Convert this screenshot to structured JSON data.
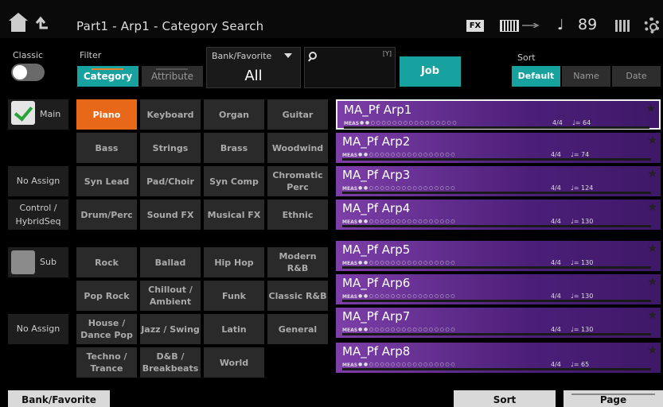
{
  "header": {
    "title": "Part1 - Arp1 - Category Search",
    "fx": "FX",
    "tempo": "89",
    "note_symbol": "♩",
    "icons": [
      "home-icon",
      "back-icon",
      "keyboard-icon",
      "usb-icon",
      "grid-icon",
      "gear-icon"
    ]
  },
  "controls": {
    "classic_label": "Classic",
    "filter_label": "Filter",
    "filter_tabs": [
      "Category",
      "Attribute"
    ],
    "bank_label": "Bank/Favorite",
    "bank_value": "All",
    "search_badge": "[Y]",
    "job": "Job",
    "sort_label": "Sort",
    "sort_options": [
      "Default",
      "Name",
      "Date"
    ]
  },
  "side": {
    "main": "Main",
    "no_assign_1": "No Assign",
    "control_hybrid": "Control / HybridSeq",
    "sub": "Sub",
    "no_assign_2": "No Assign"
  },
  "main_categories": [
    [
      "Piano",
      "Keyboard",
      "Organ",
      "Guitar"
    ],
    [
      "Bass",
      "Strings",
      "Brass",
      "Woodwind"
    ],
    [
      "Syn Lead",
      "Pad/Choir",
      "Syn Comp",
      "Chromatic Perc"
    ],
    [
      "Drum/Perc",
      "Sound FX",
      "Musical FX",
      "Ethnic"
    ]
  ],
  "sub_categories": [
    [
      "Rock",
      "Ballad",
      "Hip Hop",
      "Modern R&B"
    ],
    [
      "Pop Rock",
      "Chillout / Ambient",
      "Funk",
      "Classic R&B"
    ],
    [
      "House / Dance Pop",
      "Jazz / Swing",
      "Latin",
      "General"
    ],
    [
      "Techno / Trance",
      "D&B / Breakbeats",
      "World",
      ""
    ]
  ],
  "arps": [
    {
      "name": "MA_Pf Arp1",
      "meas": "MEAS",
      "sig": "4/4",
      "tempo": "♩= 64"
    },
    {
      "name": "MA_Pf Arp2",
      "meas": "MEAS",
      "sig": "4/4",
      "tempo": "♩= 74"
    },
    {
      "name": "MA_Pf Arp3",
      "meas": "MEAS",
      "sig": "4/4",
      "tempo": "♩= 124"
    },
    {
      "name": "MA_Pf Arp4",
      "meas": "MEAS",
      "sig": "4/4",
      "tempo": "♩= 130"
    },
    {
      "name": "MA_Pf Arp5",
      "meas": "MEAS",
      "sig": "4/4",
      "tempo": "♩= 130"
    },
    {
      "name": "MA_Pf Arp6",
      "meas": "MEAS",
      "sig": "4/4",
      "tempo": "♩= 130"
    },
    {
      "name": "MA_Pf Arp7",
      "meas": "MEAS",
      "sig": "4/4",
      "tempo": "♩= 130"
    },
    {
      "name": "MA_Pf Arp8",
      "meas": "MEAS",
      "sig": "4/4",
      "tempo": "♩= 65"
    }
  ],
  "bottom": {
    "bank_favorite": "Bank/Favorite",
    "sort": "Sort",
    "page": "Page"
  },
  "colors": {
    "accent_teal": "#17a2a0",
    "active_orange": "#e8681a",
    "arp_purple": "#7d3fa8"
  }
}
